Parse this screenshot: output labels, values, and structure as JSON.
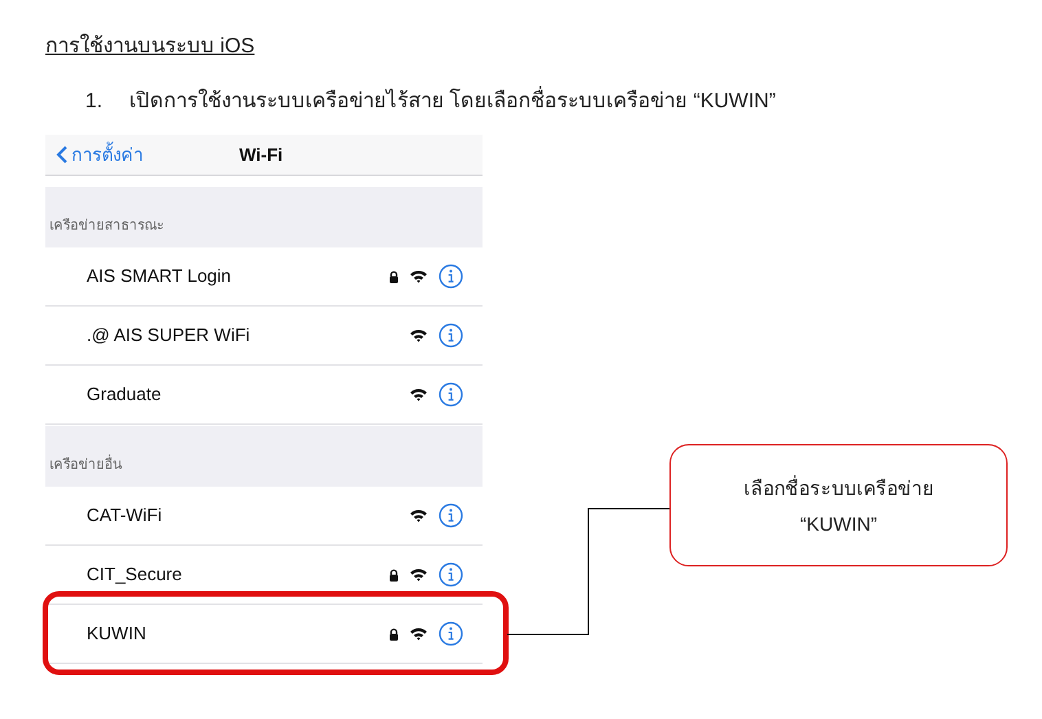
{
  "heading": "การใช้งานบนระบบ iOS",
  "steps": [
    {
      "number": "1.",
      "text": "เปิดการใช้งานระบบเครือข่ายไร้สาย โดยเลือกชื่อระบบเครือข่าย “KUWIN”"
    }
  ],
  "phone": {
    "back_label": "การตั้งค่า",
    "title": "Wi-Fi",
    "sections": [
      {
        "header": "เครือข่ายสาธารณะ",
        "networks": [
          {
            "name": "AIS SMART Login",
            "locked": true,
            "highlighted": false
          },
          {
            "name": ".@ AIS SUPER WiFi",
            "locked": false,
            "highlighted": false
          },
          {
            "name": "Graduate",
            "locked": false,
            "highlighted": false
          }
        ]
      },
      {
        "header": "เครือข่ายอื่น",
        "networks": [
          {
            "name": "CAT-WiFi",
            "locked": false,
            "highlighted": false
          },
          {
            "name": "CIT_Secure",
            "locked": true,
            "highlighted": false
          },
          {
            "name": "KUWIN",
            "locked": true,
            "highlighted": true
          }
        ]
      }
    ]
  },
  "callout": {
    "lines": [
      "เลือกชื่อระบบเครือข่าย",
      "“KUWIN”"
    ]
  }
}
